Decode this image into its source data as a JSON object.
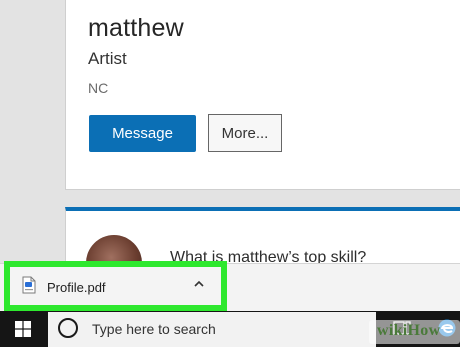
{
  "profile": {
    "name": "matthew",
    "title": "Artist",
    "location": "NC",
    "message_label": "Message",
    "more_label": "More..."
  },
  "skills": {
    "question": "What is matthew’s top skill?"
  },
  "download": {
    "filename": "Profile.pdf",
    "file_icon": "pdf-file-icon",
    "menu_icon": "chevron-up-icon",
    "highlight_color": "#2ee82e"
  },
  "taskbar": {
    "search_placeholder": "Type here to search",
    "start_icon": "windows-logo-icon",
    "cortana_icon": "cortana-icon",
    "taskview_icon": "task-view-icon",
    "edge_icon": "edge-icon"
  },
  "watermark": {
    "text": "wikiHow"
  },
  "colors": {
    "accent": "#0b6fb5",
    "taskbar": "#151515"
  }
}
